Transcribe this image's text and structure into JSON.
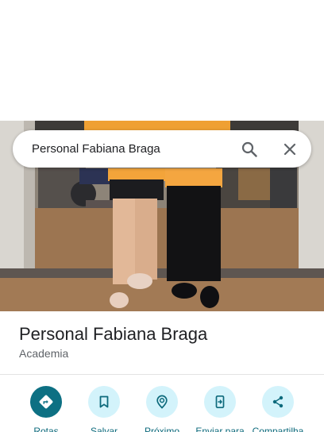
{
  "search": {
    "query": "Personal Fabiana Braga"
  },
  "place": {
    "name": "Personal Fabiana Braga",
    "category": "Academia"
  },
  "actions": [
    {
      "label": "Rotas",
      "icon": "directions-icon"
    },
    {
      "label": "Salvar",
      "icon": "bookmark-icon"
    },
    {
      "label": "Próximo",
      "icon": "nearby-icon"
    },
    {
      "label": "Enviar para",
      "icon": "send-to-phone-icon"
    },
    {
      "label": "Compartilha",
      "icon": "share-icon"
    }
  ],
  "colors": {
    "accent": "#0d7083",
    "action_bg": "#d3f3fb",
    "action_label": "#0d6a7c"
  }
}
